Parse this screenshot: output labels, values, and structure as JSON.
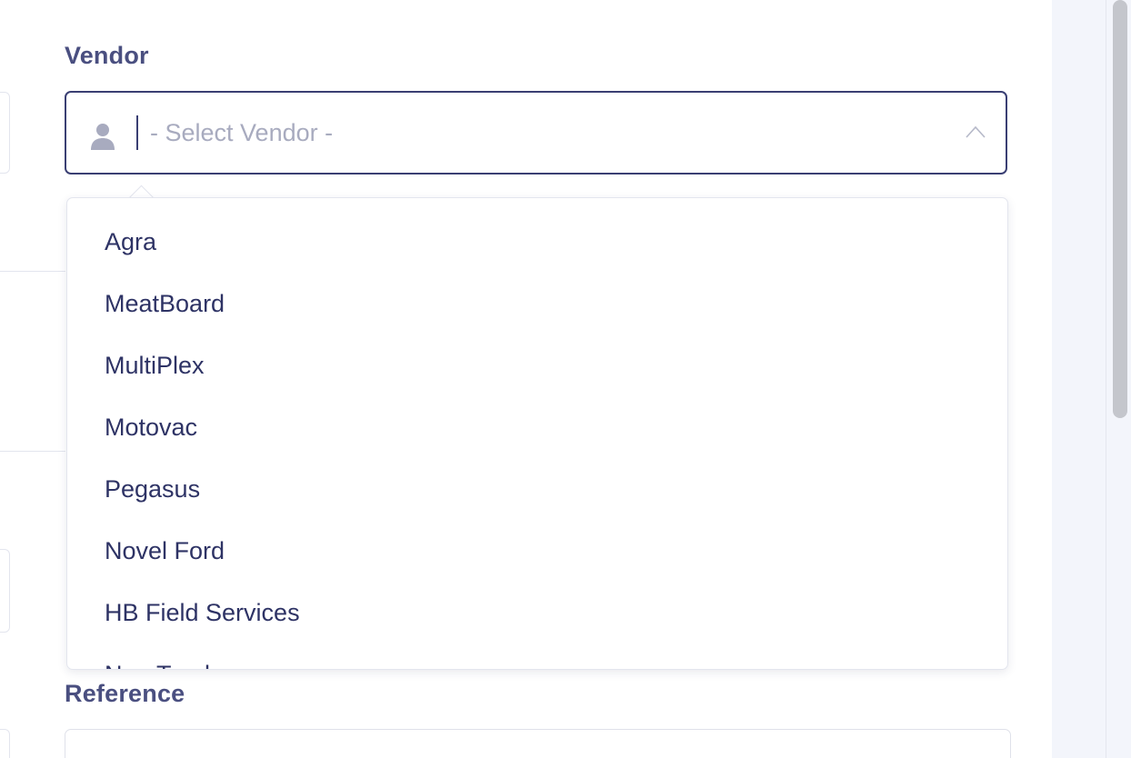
{
  "vendor_field": {
    "label": "Vendor",
    "placeholder": "- Select Vendor -",
    "icon": "user-icon",
    "toggle_icon": "chevron-up-icon"
  },
  "vendor_options": [
    "Agra",
    "MeatBoard",
    "MultiPlex",
    "Motovac",
    "Pegasus",
    "Novel Ford",
    "HB Field Services",
    "NomTrack"
  ],
  "reference_field": {
    "label": "Reference",
    "value": ""
  },
  "colors": {
    "label": "#4a4f80",
    "focus_border": "#3a3f73",
    "option_text": "#2e3365",
    "placeholder": "#a8abbf",
    "side_panel": "#f3f5fb"
  }
}
